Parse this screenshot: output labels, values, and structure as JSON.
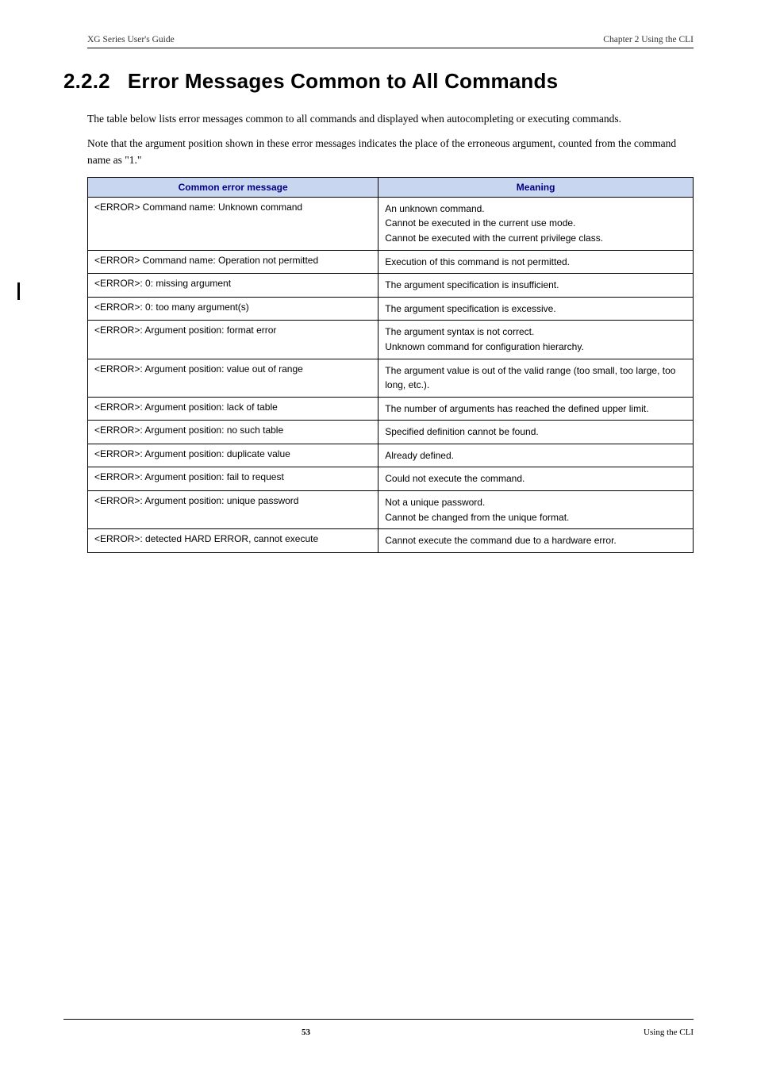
{
  "header": {
    "left": "XG Series User's Guide",
    "right": "Chapter 2 Using the CLI"
  },
  "section": {
    "number": "2.2.2",
    "title": "Error Messages Common to All Commands"
  },
  "paragraphs": {
    "p1": "The table below lists error messages common to all commands and displayed when autocompleting or executing commands.",
    "p2": "Note that the argument position shown in these error messages indicates the place of the erroneous argument, counted from the command name as \"1.\""
  },
  "table": {
    "head_msg": "Common error message",
    "head_meaning": "Meaning",
    "rows": [
      {
        "msg": "<ERROR> Command name: Unknown command",
        "meaning": [
          "An unknown command.",
          "Cannot be executed in the current use mode.",
          "Cannot be executed with the current privilege class."
        ]
      },
      {
        "msg": "<ERROR> Command name: Operation not permitted",
        "meaning": [
          "Execution of this command is not permitted."
        ]
      },
      {
        "msg": "<ERROR>: 0: missing argument",
        "meaning": [
          "The argument specification is insufficient."
        ]
      },
      {
        "msg": "<ERROR>: 0: too many argument(s)",
        "meaning": [
          "The argument specification is excessive."
        ]
      },
      {
        "msg": "<ERROR>: Argument position: format error",
        "meaning": [
          "The argument syntax is not correct.",
          "Unknown command for configuration hierarchy."
        ]
      },
      {
        "msg": "<ERROR>: Argument position: value out of range",
        "meaning": [
          "The argument value is out of the valid range (too small, too large, too long, etc.)."
        ]
      },
      {
        "msg": "<ERROR>: Argument position: lack of table",
        "meaning": [
          "The number of arguments has reached the defined upper limit."
        ]
      },
      {
        "msg": "<ERROR>: Argument position: no such table",
        "meaning": [
          "Specified definition cannot be found."
        ]
      },
      {
        "msg": "<ERROR>: Argument position: duplicate value",
        "meaning": [
          "Already defined."
        ]
      },
      {
        "msg": "<ERROR>: Argument position: fail to request",
        "meaning": [
          "Could not execute the command."
        ]
      },
      {
        "msg": "<ERROR>: Argument position: unique password",
        "meaning": [
          "Not a unique password.",
          "Cannot be changed from the unique format."
        ]
      },
      {
        "msg": "<ERROR>: detected HARD ERROR, cannot execute",
        "meaning": [
          "Cannot execute the command due to a hardware error."
        ]
      }
    ]
  },
  "footer": {
    "page_number": "53",
    "right": "Using the CLI"
  }
}
